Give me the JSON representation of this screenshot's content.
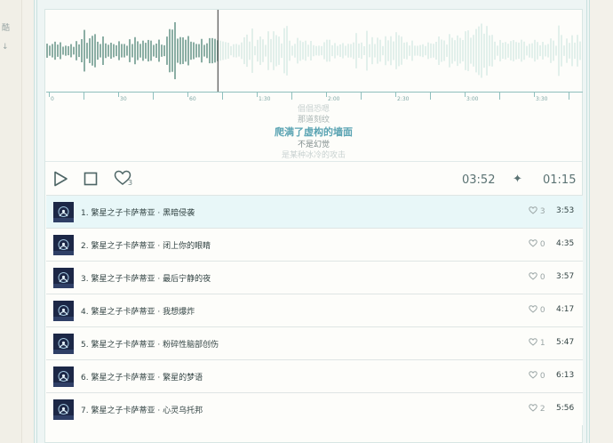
{
  "side": {
    "glyph_top": "酷",
    "glyph_bottom": "↓"
  },
  "waveform": {
    "progress": 0.32,
    "ticks": [
      "0",
      "30",
      "60",
      "1:30",
      "2:00",
      "2:30",
      "3:00",
      "3:30"
    ]
  },
  "lyrics": {
    "lines": [
      "倡倡恐嗯",
      "那道刻纹",
      "爬满了虚构的墙面",
      "不是幻觉",
      "是某种冰冷的攻击"
    ],
    "current_index": 2
  },
  "player": {
    "like_count": "3",
    "total_time": "03:52",
    "current_time": "01:15",
    "colors": {
      "accent": "#5ba4b3",
      "played": "#6f9a8f",
      "unplayed": "#dbece7"
    }
  },
  "playlist": [
    {
      "index": "1.",
      "artist": "繁星之子卡萨蒂亚",
      "sep": "·",
      "title": "黑暗侵袭",
      "likes": "3",
      "duration": "3:53",
      "active": true
    },
    {
      "index": "2.",
      "artist": "繁星之子卡萨蒂亚",
      "sep": "·",
      "title": "闭上你的眼睛",
      "likes": "0",
      "duration": "4:35",
      "active": false
    },
    {
      "index": "3.",
      "artist": "繁星之子卡萨蒂亚",
      "sep": "·",
      "title": "最后宁静的夜",
      "likes": "0",
      "duration": "3:57",
      "active": false
    },
    {
      "index": "4.",
      "artist": "繁星之子卡萨蒂亚",
      "sep": "·",
      "title": "我想爆炸",
      "likes": "0",
      "duration": "4:17",
      "active": false
    },
    {
      "index": "5.",
      "artist": "繁星之子卡萨蒂亚",
      "sep": "·",
      "title": "粉碎性脑部创伤",
      "likes": "1",
      "duration": "5:47",
      "active": false
    },
    {
      "index": "6.",
      "artist": "繁星之子卡萨蒂亚",
      "sep": "·",
      "title": "繁星的梦语",
      "likes": "0",
      "duration": "6:13",
      "active": false
    },
    {
      "index": "7.",
      "artist": "繁星之子卡萨蒂亚",
      "sep": "·",
      "title": "心灵乌托邦",
      "likes": "2",
      "duration": "5:56",
      "active": false
    }
  ]
}
